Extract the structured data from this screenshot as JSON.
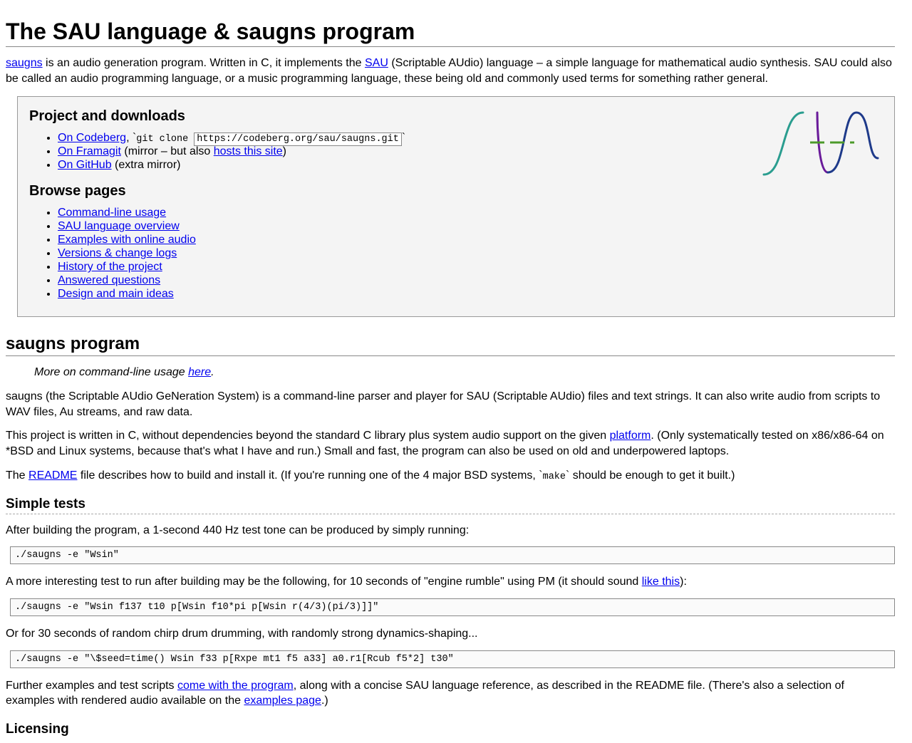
{
  "title": "The SAU language & saugns program",
  "intro": {
    "link1": "saugns",
    "t1": " is an audio generation program. Written in C, it implements the ",
    "link2": "SAU",
    "t2": " (Scriptable AUdio) language – a simple language for mathematical audio synthesis. SAU could also be called an audio programming language, or a music programming language, these being old and commonly used terms for something rather general."
  },
  "box": {
    "h1": "Project and downloads",
    "codeberg": "On Codeberg",
    "codeberg_after": ", ",
    "git_clone": "git clone ",
    "git_url": "https://codeberg.org/sau/saugns.git",
    "framagit": "On Framagit",
    "framagit_after1": " (mirror – but also ",
    "framagit_link2": "hosts this site",
    "framagit_after2": ")",
    "github": "On GitHub",
    "github_after": " (extra mirror)",
    "h2": "Browse pages",
    "pages": [
      "Command-line usage",
      "SAU language overview",
      "Examples with online audio",
      "Versions & change logs",
      "History of the project",
      "Answered questions",
      "Design and main ideas"
    ]
  },
  "program": {
    "heading": "saugns program",
    "bq1": "More on command-line usage ",
    "bq_link": "here",
    "bq2": ".",
    "p1": "saugns (the Scriptable AUdio GeNeration System) is a command-line parser and player for SAU (Scriptable AUdio) files and text strings. It can also write audio from scripts to WAV files, Au streams, and raw data.",
    "p2a": "This project is written in C, without dependencies beyond the standard C library plus system audio support on the given ",
    "p2_link": "platform",
    "p2b": ". (Only systematically tested on x86/x86-64 on *BSD and Linux systems, because that's what I have and run.) Small and fast, the program can also be used on old and underpowered laptops.",
    "p3a": "The ",
    "p3_link": "README",
    "p3b": " file describes how to build and install it. (If you're running one of the 4 major BSD systems, `",
    "p3_code": "make",
    "p3c": "` should be enough to get it built.)"
  },
  "tests": {
    "heading": "Simple tests",
    "p1": "After building the program, a 1-second 440 Hz test tone can be produced by simply running:",
    "code1": "./saugns -e \"Wsin\"",
    "p2a": "A more interesting test to run after building may be the following, for 10 seconds of \"engine rumble\" using PM (it should sound ",
    "p2_link": "like this",
    "p2b": "):",
    "code2": "./saugns -e \"Wsin f137 t10 p[Wsin f10*pi p[Wsin r(4/3)(pi/3)]]\"",
    "p3": "Or for 30 seconds of random chirp drum drumming, with randomly strong dynamics-shaping...",
    "code3": "./saugns -e \"\\$seed=time() Wsin f33 p[Rxpe mt1 f5 a33] a0.r1[Rcub f5*2] t30\"",
    "p4a": "Further examples and test scripts ",
    "p4_link1": "come with the program",
    "p4b": ", along with a concise SAU language reference, as described in the README file. (There's also a selection of examples with rendered audio available on the ",
    "p4_link2": "examples page",
    "p4c": ".)"
  },
  "licensing_heading": "Licensing"
}
